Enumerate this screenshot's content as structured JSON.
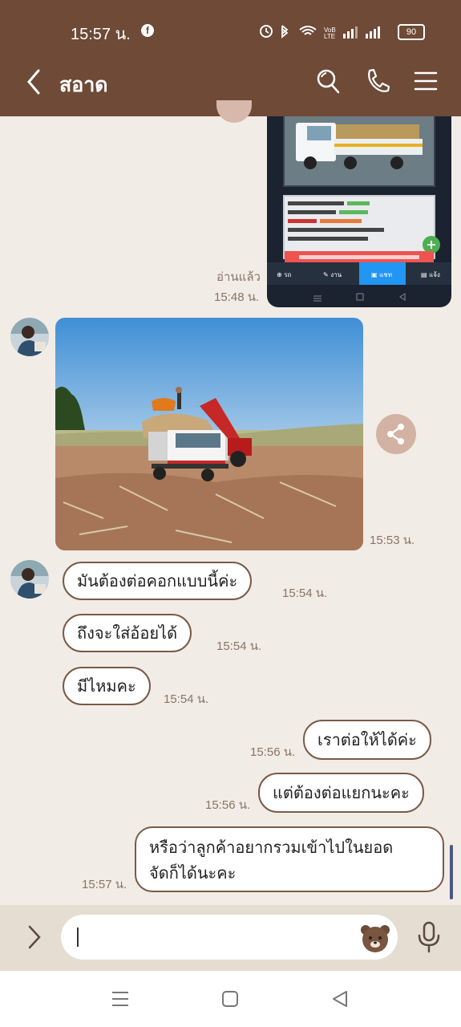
{
  "status_bar": {
    "time": "15:57 น.",
    "battery": "90"
  },
  "header": {
    "title": "สอาด"
  },
  "messages": {
    "sent_image_read": "อ่านแล้ว",
    "sent_image_time": "15:48 น.",
    "received_image_time": "15:53 น.",
    "received": [
      {
        "text": "มันต้องต่อคอกแบบนี้ค่ะ",
        "time": "15:54 น."
      },
      {
        "text": "ถึงจะใส่อ้อยได้",
        "time": "15:54 น."
      },
      {
        "text": "มีไหมคะ",
        "time": "15:54 น."
      }
    ],
    "sent": [
      {
        "text": "เราต่อให้ได้ค่ะ",
        "time": "15:56 น."
      },
      {
        "text": "แต่ต้องต่อแยกนะคะ",
        "time": "15:56 น."
      },
      {
        "line1": "หรือว่าลูกค้าอยากรวมเข้าไปในยอด",
        "line2": "จัดก็ได้นะคะ",
        "time": "15:57 น."
      }
    ]
  },
  "icons": {
    "back": "chevron-left-icon",
    "search": "search-icon",
    "call": "phone-icon",
    "menu": "hamburger-menu-icon",
    "share": "share-icon",
    "expand": "chevron-right-icon",
    "sticker": "bear-sticker-icon",
    "mic": "microphone-icon"
  },
  "colors": {
    "header": "#6e4a37",
    "chat_bg": "#f1ece6",
    "bubble_border": "#7a5a48",
    "time_text": "#8a7466"
  }
}
